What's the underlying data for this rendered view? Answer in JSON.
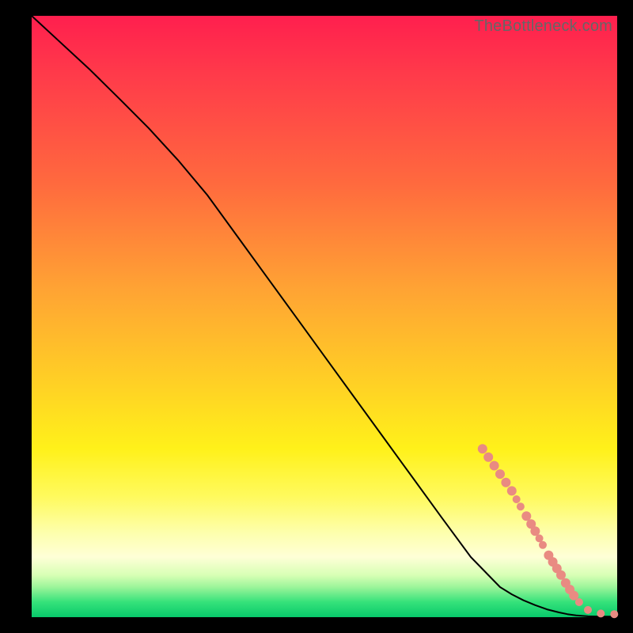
{
  "watermark": "TheBottleneck.com",
  "chart_data": {
    "type": "line",
    "title": "",
    "xlabel": "",
    "ylabel": "",
    "xlim": [
      0,
      100
    ],
    "ylim": [
      0,
      100
    ],
    "grid": false,
    "legend": false,
    "series": [
      {
        "name": "curve",
        "color": "#000000",
        "x": [
          0,
          5,
          10,
          15,
          20,
          25,
          30,
          35,
          40,
          45,
          50,
          55,
          60,
          65,
          70,
          75,
          80,
          82,
          84,
          86,
          88,
          90,
          91.5,
          93,
          95,
          97,
          100
        ],
        "y": [
          100,
          95.5,
          91,
          86.2,
          81.3,
          76.0,
          70.2,
          63.5,
          56.8,
          50.1,
          43.4,
          36.7,
          30.0,
          23.3,
          16.6,
          10.0,
          5.0,
          3.8,
          2.8,
          2.0,
          1.3,
          0.8,
          0.5,
          0.3,
          0.15,
          0.1,
          0.1
        ]
      }
    ],
    "markers": {
      "name": "markers",
      "color": "#e98b82",
      "points": [
        {
          "x": 77.0,
          "y": 28.0,
          "r": 6
        },
        {
          "x": 78.0,
          "y": 26.6,
          "r": 6
        },
        {
          "x": 79.0,
          "y": 25.2,
          "r": 6
        },
        {
          "x": 80.0,
          "y": 23.8,
          "r": 6
        },
        {
          "x": 81.0,
          "y": 22.4,
          "r": 6
        },
        {
          "x": 82.0,
          "y": 21.0,
          "r": 6
        },
        {
          "x": 82.8,
          "y": 19.6,
          "r": 5
        },
        {
          "x": 83.5,
          "y": 18.4,
          "r": 5
        },
        {
          "x": 84.5,
          "y": 16.8,
          "r": 6
        },
        {
          "x": 85.3,
          "y": 15.5,
          "r": 6
        },
        {
          "x": 86.0,
          "y": 14.3,
          "r": 6
        },
        {
          "x": 86.7,
          "y": 13.1,
          "r": 5
        },
        {
          "x": 87.3,
          "y": 12.0,
          "r": 5
        },
        {
          "x": 88.3,
          "y": 10.3,
          "r": 6
        },
        {
          "x": 89.0,
          "y": 9.2,
          "r": 6
        },
        {
          "x": 89.7,
          "y": 8.1,
          "r": 6
        },
        {
          "x": 90.4,
          "y": 7.0,
          "r": 6
        },
        {
          "x": 91.2,
          "y": 5.7,
          "r": 6
        },
        {
          "x": 91.9,
          "y": 4.6,
          "r": 6
        },
        {
          "x": 92.6,
          "y": 3.6,
          "r": 6
        },
        {
          "x": 93.5,
          "y": 2.5,
          "r": 5
        },
        {
          "x": 95.0,
          "y": 1.2,
          "r": 5
        },
        {
          "x": 97.2,
          "y": 0.6,
          "r": 5
        },
        {
          "x": 99.5,
          "y": 0.5,
          "r": 5
        }
      ]
    }
  }
}
